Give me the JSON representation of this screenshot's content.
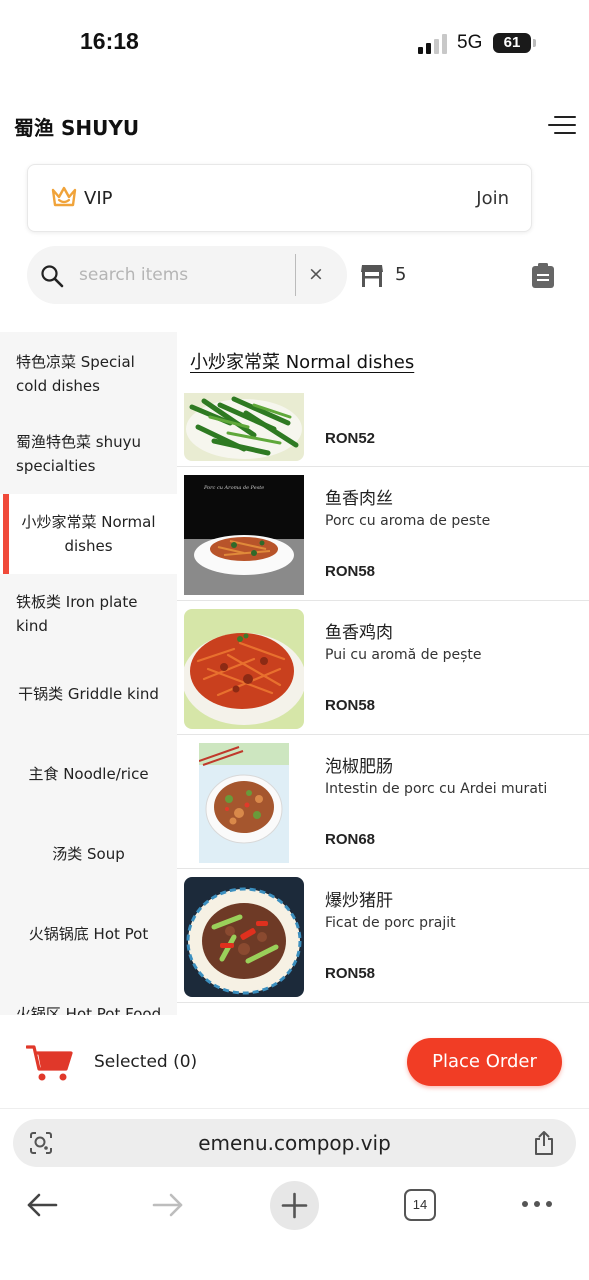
{
  "status_bar": {
    "time": "16:18",
    "network": "5G",
    "battery": "61"
  },
  "header": {
    "title": "蜀渔 SHUYU"
  },
  "vip": {
    "label": "VIP",
    "join": "Join"
  },
  "search": {
    "placeholder": "search items",
    "clear": "×"
  },
  "table": {
    "number": "5"
  },
  "categories": [
    {
      "label": "特色凉菜 Special cold dishes"
    },
    {
      "label": "蜀渔特色菜 shuyu specialties"
    },
    {
      "label": "小炒家常菜 Normal dishes"
    },
    {
      "label": "铁板类 Iron plate kind"
    },
    {
      "label": "干锅类 Griddle kind"
    },
    {
      "label": "主食 Noodle/rice"
    },
    {
      "label": "汤类 Soup"
    },
    {
      "label": "火锅锅底 Hot Pot"
    },
    {
      "label": "火锅区 Hot Pot Food"
    }
  ],
  "active_category_index": 2,
  "section": {
    "title": "小炒家常菜 Normal dishes"
  },
  "dishes": [
    {
      "name": "",
      "subtitle": "",
      "price": "RON52",
      "image_icon": "stir-fried-greens-photo"
    },
    {
      "name": "鱼香肉丝",
      "subtitle": "Porc cu aroma de peste",
      "price": "RON58",
      "image_icon": "shredded-pork-photo"
    },
    {
      "name": "鱼香鸡肉",
      "subtitle": "Pui cu aromă de pește",
      "price": "RON58",
      "image_icon": "shredded-chicken-photo"
    },
    {
      "name": "泡椒肥肠",
      "subtitle": "Intestin de porc cu Ardei murati",
      "price": "RON68",
      "image_icon": "pork-intestine-photo"
    },
    {
      "name": "爆炒猪肝",
      "subtitle": "Ficat de porc prajit",
      "price": "RON58",
      "image_icon": "pork-liver-photo"
    }
  ],
  "dish_photo_caption": "Porc cu Aroma de Peste",
  "cart": {
    "selected": "Selected (0)",
    "order_button": "Place Order"
  },
  "browser": {
    "url": "emenu.compop.vip",
    "tabs_count": "14"
  },
  "colors": {
    "accent": "#f13d25",
    "marker": "#f04a3a",
    "vip_gold": "#f0a33a",
    "sidebar_bg": "#f6f6f6"
  },
  "icons": [
    "crown-icon",
    "search-icon",
    "close-icon",
    "table-icon",
    "clipboard-icon",
    "cart-icon",
    "menu-icon",
    "lens-icon",
    "share-icon",
    "back-icon",
    "forward-icon",
    "plus-icon",
    "tabs-icon",
    "more-icon"
  ]
}
